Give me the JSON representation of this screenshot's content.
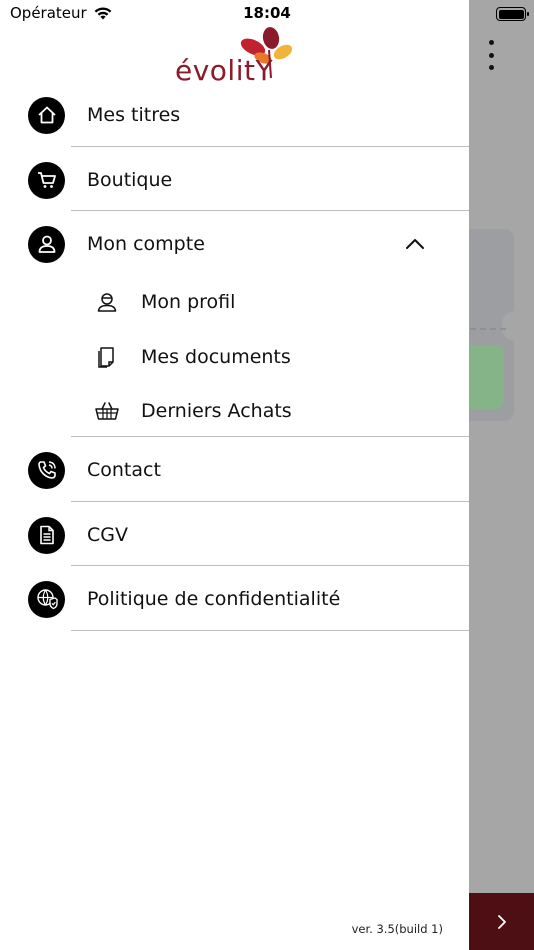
{
  "status_bar": {
    "carrier": "Opérateur",
    "time": "18:04"
  },
  "logo": {
    "text": "évolitY",
    "colors": {
      "text": "#8b1a2b",
      "leaf_red": "#c0222e",
      "leaf_orange": "#e8792b",
      "leaf_yellow": "#f0b43c",
      "leaf_darkred": "#8b1a2b"
    }
  },
  "menu": {
    "items": [
      {
        "label": "Mes titres",
        "icon": "home-icon"
      },
      {
        "label": "Boutique",
        "icon": "cart-icon"
      },
      {
        "label": "Mon compte",
        "icon": "user-icon",
        "expanded": true
      },
      {
        "label": "Contact",
        "icon": "phone-icon"
      },
      {
        "label": "CGV",
        "icon": "document-icon"
      },
      {
        "label": "Politique de confidentialité",
        "icon": "shield-globe-icon"
      }
    ],
    "submenu": [
      {
        "label": "Mon profil",
        "icon": "profile-icon"
      },
      {
        "label": "Mes documents",
        "icon": "documents-icon"
      },
      {
        "label": "Derniers Achats",
        "icon": "basket-icon"
      }
    ]
  },
  "version": "ver. 3.5(build 1)",
  "colors": {
    "accent": "#4e0f14",
    "overlay": "#a6a6a6",
    "drawer_bg": "#ffffff"
  }
}
